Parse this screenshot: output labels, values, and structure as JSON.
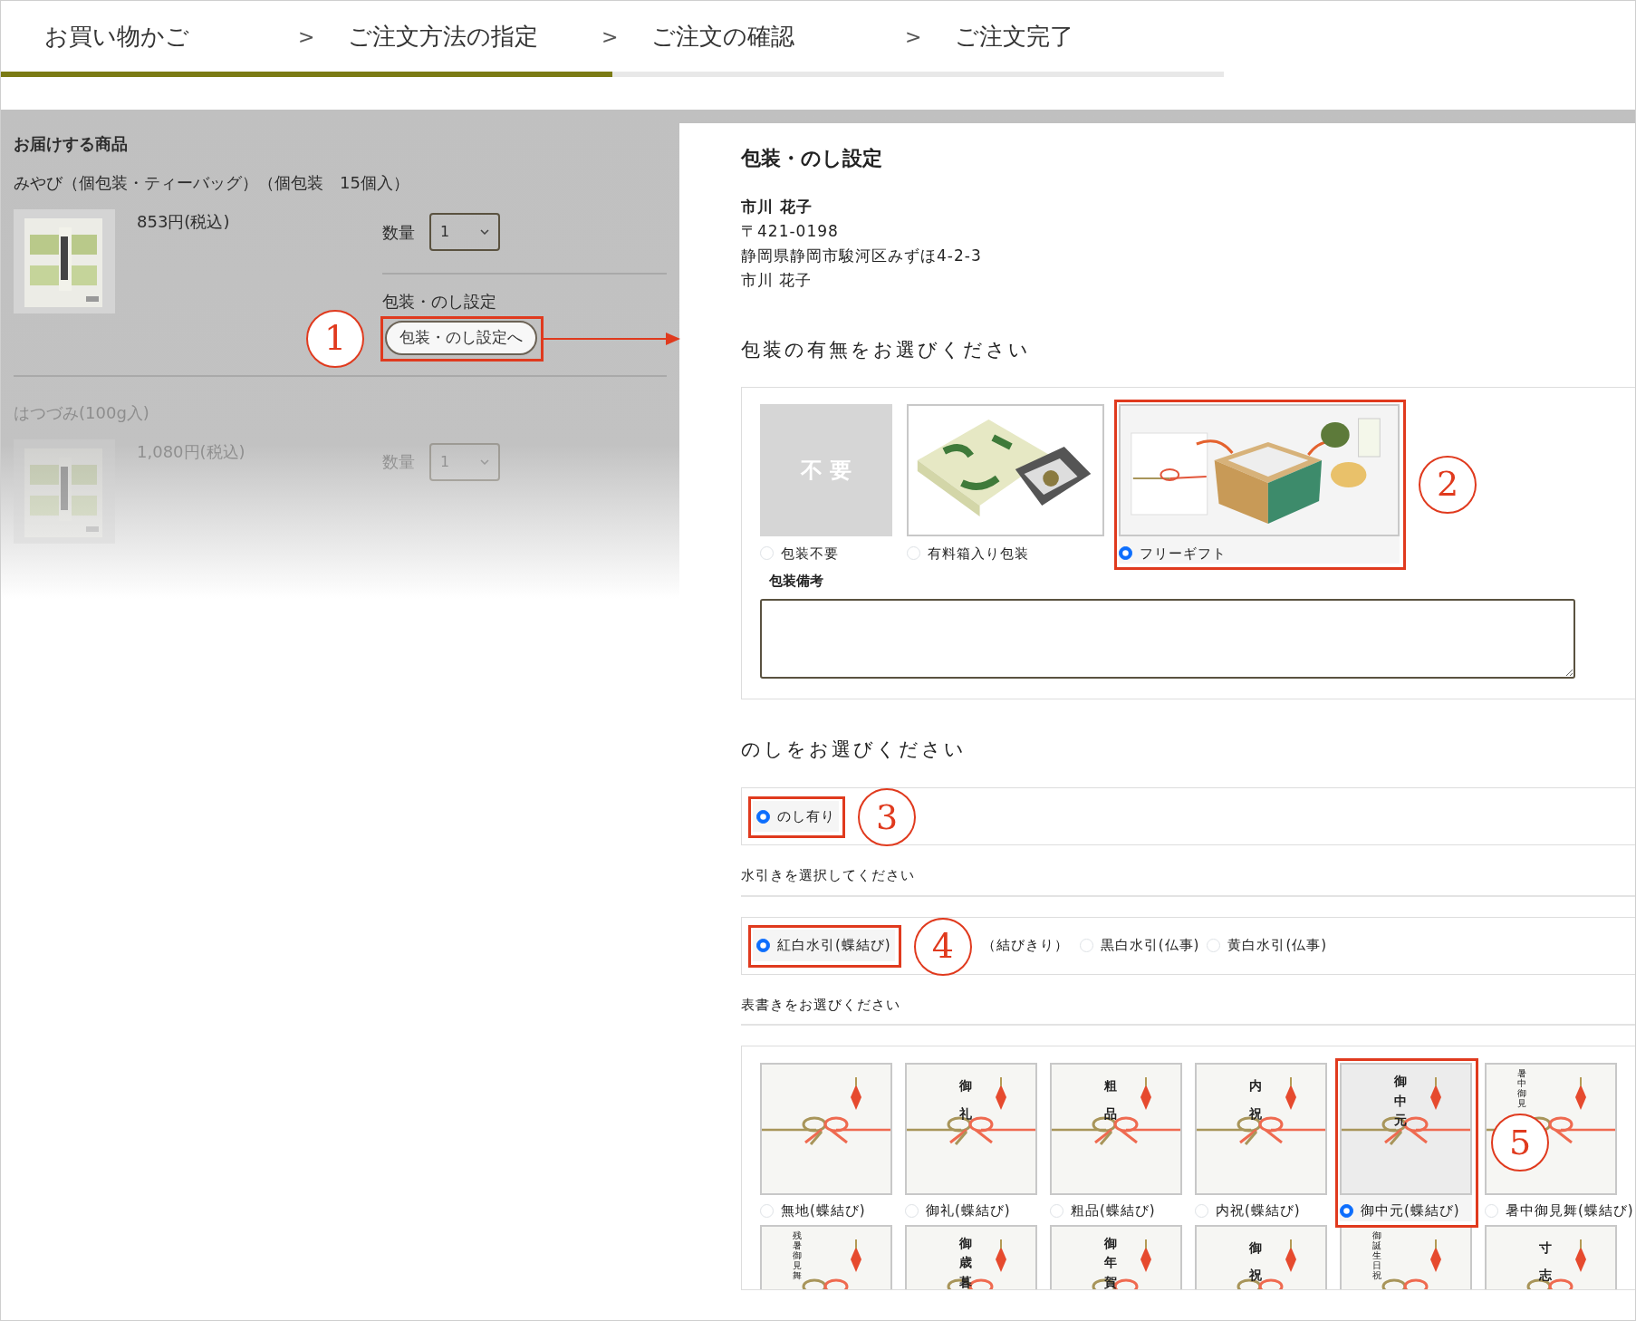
{
  "steps": [
    {
      "label": "お買い物かご",
      "arrow": ">"
    },
    {
      "label": "ご注文方法の指定",
      "arrow": ">"
    },
    {
      "label": "ご注文の確認",
      "arrow": ">"
    },
    {
      "label": "ご注文完了"
    }
  ],
  "progress": {
    "level": 0.5
  },
  "cart": {
    "heading": "お届けする商品",
    "items": [
      {
        "name": "みやび（個包装・ティーバッグ）（個包装　15個入）",
        "price": "853円(税込)",
        "quantity_label": "数量",
        "quantity": "1",
        "settings_label": "包装・のし設定",
        "settings_button": "包装・のし設定へ",
        "callout": {
          "number": "1",
          "arrow": true
        },
        "faded": false
      },
      {
        "name": "はつづみ(100g入)",
        "price": "1,080円(税込)",
        "quantity_label": "数量",
        "quantity": "1",
        "faded": true
      }
    ]
  },
  "dialog": {
    "title": "包装・のし設定",
    "recipient": {
      "name": "市川 花子",
      "postal": "〒421-0198",
      "address": "静岡県静岡市駿河区みずほ4-2-3",
      "addressee": "市川 花子"
    },
    "wrapping": {
      "heading": "包装の有無をお選びください",
      "options": [
        {
          "kind": "blank",
          "tile_text": "不 要",
          "label": "包装不要",
          "selected": false
        },
        {
          "kind": "wrapped",
          "label": "有料箱入り包装",
          "selected": false
        },
        {
          "kind": "gift",
          "label": "フリーギフト",
          "selected": true,
          "callout": {
            "number": "2"
          }
        }
      ],
      "note_label": "包装備考"
    },
    "noshi": {
      "heading": "のしをお選びください",
      "options": [
        {
          "label": "のし有り",
          "selected": true,
          "callout": {
            "number": "3"
          }
        }
      ]
    },
    "mizuhiki": {
      "heading": "水引きを選択してください",
      "options": [
        {
          "kind": "radio",
          "label": "紅白水引(蝶結び)",
          "selected": true,
          "callout": {
            "number": "4"
          }
        },
        {
          "kind": "text",
          "label": "（結びきり）"
        },
        {
          "kind": "radio",
          "label": "黒白水引(仏事)",
          "selected": false
        },
        {
          "kind": "radio",
          "label": "黄白水引(仏事)",
          "selected": false
        }
      ]
    },
    "omote": {
      "heading": "表書きをお選びください",
      "options": [
        {
          "label": "無地(蝶結び)",
          "selected": false
        },
        {
          "label": "御礼(蝶結び)",
          "inscription": "御礼",
          "selected": false
        },
        {
          "label": "粗品(蝶結び)",
          "inscription": "粗品",
          "selected": false
        },
        {
          "label": "内祝(蝶結び)",
          "inscription": "内祝",
          "selected": false
        },
        {
          "label": "御中元(蝶結び)",
          "inscription": "御中元",
          "selected": true,
          "callout": {
            "number": "5"
          }
        },
        {
          "label": "暑中御見舞(蝶結び)",
          "inscription": "暑中御見",
          "selected": false
        }
      ],
      "more": [
        {
          "inscription": "残暑御見舞"
        },
        {
          "inscription": "御歳暮"
        },
        {
          "inscription": "御年賀"
        },
        {
          "inscription": "御祝"
        },
        {
          "inscription": "御誕生日祝"
        },
        {
          "inscription": "寸志"
        }
      ]
    }
  }
}
